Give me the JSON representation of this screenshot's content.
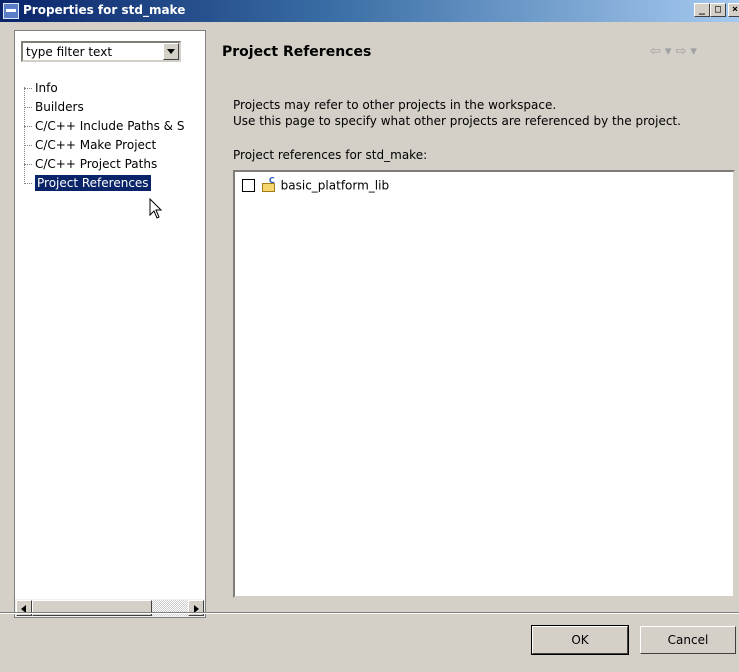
{
  "window": {
    "title": "Properties for std_make"
  },
  "filter": {
    "text": "type filter text"
  },
  "tree": {
    "items": [
      {
        "label": "Info"
      },
      {
        "label": "Builders"
      },
      {
        "label": "C/C++ Include Paths & S"
      },
      {
        "label": "C/C++ Make Project"
      },
      {
        "label": "C/C++ Project Paths"
      },
      {
        "label": "Project References",
        "selected": true
      }
    ]
  },
  "page": {
    "title": "Project References",
    "description_line1": "Projects may refer to other projects in the workspace.",
    "description_line2": "Use this page to specify what other projects are referenced by the project.",
    "list_label": "Project references for std_make:",
    "projects": [
      {
        "name": "basic_platform_lib",
        "checked": false
      }
    ]
  },
  "buttons": {
    "ok": "OK",
    "cancel": "Cancel"
  }
}
